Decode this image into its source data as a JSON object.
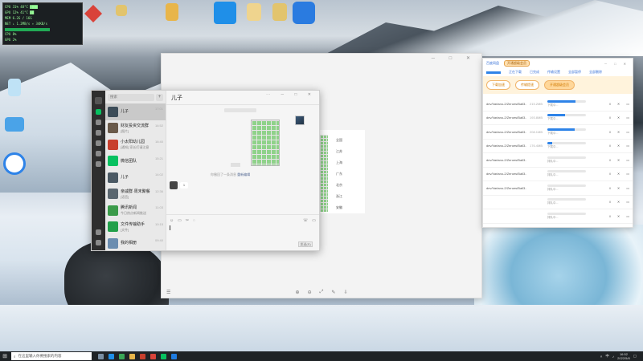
{
  "hwmon": {
    "rows": [
      "CPU  31%  48°C  ████",
      "GPU  12%  41°C  ██",
      "MEM  6.2G / 16G",
      "NET ↓ 1.2MB/s  ↑ 34KB/s"
    ],
    "cpu_label": "CPU 8%",
    "gpu_label": "GPU 2%"
  },
  "desktop_icons": [
    {
      "label": "",
      "color": "#d9433a"
    },
    {
      "label": "",
      "color": "#e2c46d"
    },
    {
      "label": "",
      "color": "#e8b54a"
    },
    {
      "label": "",
      "color": "#1f8fe8"
    },
    {
      "label": "",
      "color": "#efd48e"
    },
    {
      "label": "",
      "color": "#e2c46d"
    },
    {
      "label": "",
      "color": "#2a7be0"
    },
    {
      "label": "",
      "color": "#bfe2f6"
    },
    {
      "label": "",
      "color": "#4aa3e8"
    },
    {
      "label": "",
      "color": "#ffffff"
    }
  ],
  "chat": {
    "title": "儿子",
    "search_placeholder": "搜索",
    "plus": "+",
    "conversations": [
      {
        "name": "儿子",
        "preview": "",
        "time": "17:01",
        "color": "#3c4c58"
      },
      {
        "name": "财友投资交流群",
        "preview": "[图片]",
        "time": "16:52",
        "color": "#6a5a4a"
      },
      {
        "name": "小太阳幼儿园",
        "preview": "[通知] 家长们请注意",
        "time": "16:40",
        "color": "#c8402e"
      },
      {
        "name": "微信团队",
        "preview": "",
        "time": "15:21",
        "color": "#07c160"
      },
      {
        "name": "儿子",
        "preview": "",
        "time": "14:02",
        "color": "#4b5964"
      },
      {
        "name": "亲戚群·周末聚餐",
        "preview": "[语音]",
        "time": "12:36",
        "color": "#5b6770"
      },
      {
        "name": "腾讯新闻",
        "preview": "今日热点新闻推送",
        "time": "11:03",
        "color": "#3b9b4a"
      },
      {
        "name": "文件传输助手",
        "preview": "[文件]",
        "time": "10:15",
        "color": "#22a04a"
      },
      {
        "name": "我的相册",
        "preview": "",
        "time": "09:40",
        "color": "#6b8db0"
      }
    ],
    "system_msg": "你撤回了一条消息",
    "system_link": "重新编辑",
    "reply": "1",
    "send_label": "发送(S)",
    "window_controls": "⋯ ─ □ ✕"
  },
  "sheet": {
    "labels": [
      "全国",
      "江苏",
      "上海",
      "广东",
      "北京",
      "浙江",
      "安徽"
    ]
  },
  "bigwin": {
    "controls": "─ □ ✕",
    "bottom_tools": [
      "⊕",
      "⊖",
      "⤢",
      "✎",
      "⇩"
    ],
    "left_tool": "☰"
  },
  "dlm": {
    "app_name": "百度网盘",
    "vip": "开通超级会员",
    "controls": "─ □ ✕",
    "sub_items": [
      "正在下载",
      "已完成",
      "传输设置",
      "全部暂停",
      "全部删除"
    ],
    "pills": [
      "下载加速",
      "传输提速",
      "开通超级会员"
    ],
    "rows": [
      {
        "file": "dev/Varlano-2/Zeroes/Ball3...",
        "size": "215.2MB",
        "progress": 0.72,
        "status": "下载中..."
      },
      {
        "file": "dev/Varlano-2/Zeroes/Ball3...",
        "size": "193.8MB",
        "progress": 0.45,
        "status": "下载中..."
      },
      {
        "file": "dev/Varlano-2/Zeroes/Ball3...",
        "size": "208.1MB",
        "progress": 0.7,
        "status": "下载中..."
      },
      {
        "file": "dev/Varlano-2/Zeroes/Ball3...",
        "size": "176.4MB",
        "progress": 0.12,
        "status": "下载中..."
      },
      {
        "file": "dev/Varlano-2/Zeroes/Ball3...",
        "size": "",
        "progress": 0,
        "status": "排队中..."
      },
      {
        "file": "dev/Varlano-2/Zeroes/Ball3...",
        "size": "",
        "progress": 0,
        "status": "排队中..."
      },
      {
        "file": "dev/Varlano-2/Zeroes/Ball3...",
        "size": "",
        "progress": 0,
        "status": "排队中..."
      },
      {
        "file": "",
        "size": "",
        "progress": 0,
        "status": "排队中..."
      },
      {
        "file": "",
        "size": "",
        "progress": 0,
        "status": "排队中..."
      }
    ]
  },
  "taskbar": {
    "start": "⊞",
    "search_placeholder": "在这里输入你要搜索的内容",
    "app_colors": [
      "#7a8fa3",
      "#1f8fe8",
      "#3aa757",
      "#e8b54a",
      "#c8402e",
      "#d9433a",
      "#07c160",
      "#1e7be0"
    ],
    "time": "16:52",
    "date": "2022/5/8",
    "ime": "中"
  }
}
